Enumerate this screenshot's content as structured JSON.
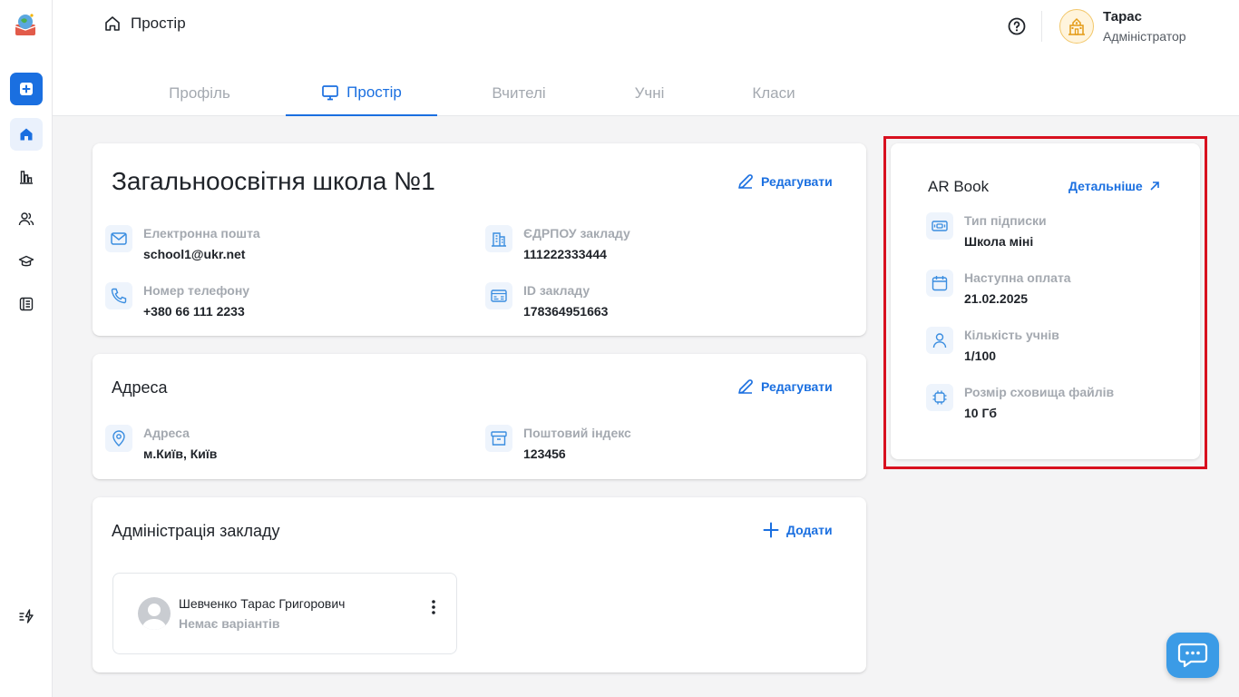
{
  "breadcrumb": {
    "label": "Простір"
  },
  "user": {
    "name": "Тарас",
    "role": "Адміністратор"
  },
  "tabs": [
    {
      "label": "Профіль"
    },
    {
      "label": "Простір"
    },
    {
      "label": "Вчителі"
    },
    {
      "label": "Учні"
    },
    {
      "label": "Класи"
    }
  ],
  "school_card": {
    "title": "Загальноосвітня школа №1",
    "edit_label": "Редагувати",
    "fields": [
      {
        "label": "Електронна пошта",
        "value": "school1@ukr.net",
        "icon": "mail-icon"
      },
      {
        "label": "ЄДРПОУ закладу",
        "value": "111222333444",
        "icon": "building-icon"
      },
      {
        "label": "Номер телефону",
        "value": "+380 66 111 2233",
        "icon": "phone-icon"
      },
      {
        "label": "ID закладу",
        "value": "178364951663",
        "icon": "id-card-icon"
      }
    ]
  },
  "address_card": {
    "title": "Адреса",
    "edit_label": "Редагувати",
    "fields": [
      {
        "label": "Адреса",
        "value": "м.Київ, Київ",
        "icon": "location-pin-icon"
      },
      {
        "label": "Поштовий індекс",
        "value": "123456",
        "icon": "archive-box-icon"
      }
    ]
  },
  "admin_card": {
    "title": "Адміністрація закладу",
    "add_label": "Додати",
    "people": [
      {
        "name": "Шевченко Тарас Григорович",
        "subtitle": "Немає варіантів"
      }
    ]
  },
  "subscription": {
    "title": "AR Book",
    "details_label": "Детальніше",
    "fields": [
      {
        "label": "Тип підписки",
        "value": "Школа міні",
        "icon": "ticket-icon"
      },
      {
        "label": "Наступна оплата",
        "value": "21.02.2025",
        "icon": "calendar-icon"
      },
      {
        "label": "Кількість учнів",
        "value": "1/100",
        "icon": "user-icon"
      },
      {
        "label": "Розмір сховища файлів",
        "value": "10 Гб",
        "icon": "chip-icon"
      }
    ]
  },
  "colors": {
    "accent": "#1a6fe0",
    "highlight_frame": "#d8101f",
    "chat": "#3b9be6"
  }
}
